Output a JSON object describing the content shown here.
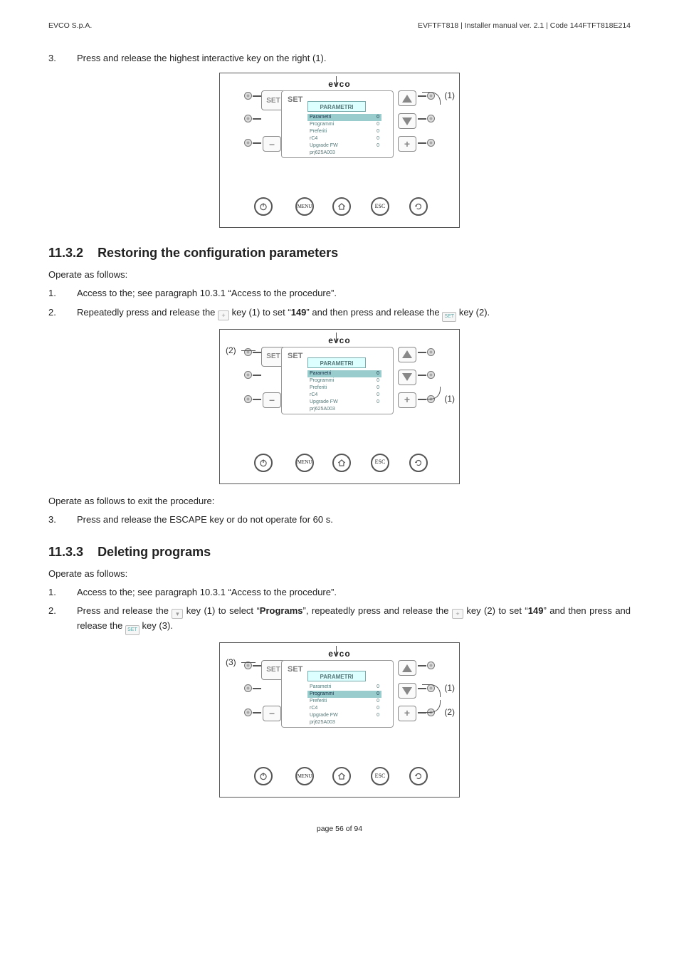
{
  "header": {
    "left": "EVCO S.p.A.",
    "right": "EVFTFT818 | Installer manual ver. 2.1 | Code 144FTFT818E214"
  },
  "step3a": {
    "num": "3.",
    "text": "Press and release the highest interactive key on the right (1)."
  },
  "h1": {
    "num": "11.3.2",
    "title": "Restoring the configuration parameters"
  },
  "opfollows": "Operate as follows:",
  "s1": {
    "num": "1.",
    "text": "Access to the; see paragraph 10.3.1 “Access to the procedure”."
  },
  "s2": {
    "num": "2.",
    "pre": "Repeatedly press and release the ",
    "mid": " key (1) to set “",
    "bold": "149",
    "post": "” and then press and release the ",
    "tail": " key (2)."
  },
  "exitline": "Operate as follows to exit the procedure:",
  "s3": {
    "num": "3.",
    "text": "Press and release the ESCAPE key or do not operate for 60 s."
  },
  "h2": {
    "num": "11.3.3",
    "title": "Deleting programs"
  },
  "d1": {
    "num": "1.",
    "text": "Access to the; see paragraph 10.3.1 “Access to the procedure”."
  },
  "d2": {
    "num": "2.",
    "p1": "Press and release the ",
    "p2": " key (1) to select “",
    "b1": "Programs",
    "p3": "”, repeatedly press and release the ",
    "p4": " key (2) to set “",
    "b2": "149",
    "p5": "” and then press and release the ",
    "p6": " key (3)."
  },
  "panel": {
    "tab": "PARAMETRI",
    "rows": [
      {
        "l": "Parametri",
        "r": "0"
      },
      {
        "l": "Programmi",
        "r": "0"
      },
      {
        "l": "Preferiti",
        "r": "0"
      },
      {
        "l": "rC4",
        "r": "0"
      },
      {
        "l": "Upgrade FW",
        "r": "0"
      },
      {
        "l": "prj625A003",
        "r": ""
      }
    ],
    "set": "SET"
  },
  "btns": {
    "menu": "MENU",
    "esc": "ESC"
  },
  "callouts": {
    "c1": "(1)",
    "c2": "(2)",
    "c3": "(3)"
  },
  "footer": "page 56 of 94"
}
